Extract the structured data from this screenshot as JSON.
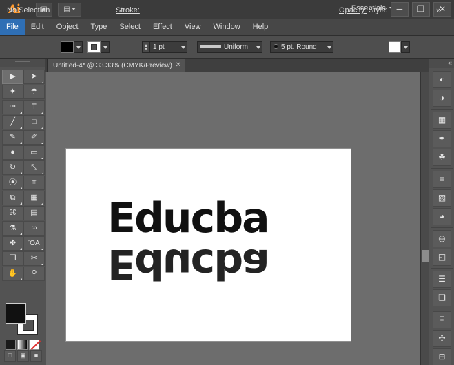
{
  "app": {
    "name": "Ai",
    "logo_label": "Ai"
  },
  "titlebar": {
    "bridge_button": "▣",
    "arrange_button": "▤",
    "workspace": "Essentials",
    "minimize": "─",
    "maximize": "❐",
    "close": "✕"
  },
  "menubar": {
    "items": [
      {
        "label": "File",
        "active": true
      },
      {
        "label": "Edit",
        "active": false
      },
      {
        "label": "Object",
        "active": false
      },
      {
        "label": "Type",
        "active": false
      },
      {
        "label": "Select",
        "active": false
      },
      {
        "label": "Effect",
        "active": false
      },
      {
        "label": "View",
        "active": false
      },
      {
        "label": "Window",
        "active": false
      },
      {
        "label": "Help",
        "active": false
      }
    ]
  },
  "controlbar": {
    "selection_status": "No Selection",
    "fill_color": "#000000",
    "stroke_color": "#ffffff",
    "stroke_label": "Stroke:",
    "stroke_weight": "1 pt",
    "stroke_profile": "Uniform",
    "brush_definition": "5 pt. Round",
    "opacity_label": "Opacity:",
    "opacity_value": "",
    "style_label": "Style:",
    "style_value": "",
    "overflow_menu": "»"
  },
  "document": {
    "tab_title": "Untitled-4* @ 33.33% (CMYK/Preview)",
    "tab_close": "✕",
    "zoom": "33.33%",
    "color_mode": "CMYK/Preview"
  },
  "artwork": {
    "text": "Educba",
    "reflection_text": "Educba",
    "color": "#111111"
  },
  "toolbox": {
    "tools": [
      {
        "name": "selection-tool",
        "glyph": "▶",
        "selected": true,
        "hasflyout": false
      },
      {
        "name": "direct-selection-tool",
        "glyph": "➤",
        "selected": false,
        "hasflyout": true
      },
      {
        "name": "magic-wand-tool",
        "glyph": "✦",
        "selected": false,
        "hasflyout": false
      },
      {
        "name": "lasso-tool",
        "glyph": "☂",
        "selected": false,
        "hasflyout": false
      },
      {
        "name": "pen-tool",
        "glyph": "✑",
        "selected": false,
        "hasflyout": true
      },
      {
        "name": "type-tool",
        "glyph": "T",
        "selected": false,
        "hasflyout": true
      },
      {
        "name": "line-segment-tool",
        "glyph": "╱",
        "selected": false,
        "hasflyout": true
      },
      {
        "name": "rectangle-tool",
        "glyph": "□",
        "selected": false,
        "hasflyout": true
      },
      {
        "name": "paintbrush-tool",
        "glyph": "✎",
        "selected": false,
        "hasflyout": true
      },
      {
        "name": "pencil-tool",
        "glyph": "✐",
        "selected": false,
        "hasflyout": true
      },
      {
        "name": "blob-brush-tool",
        "glyph": "●",
        "selected": false,
        "hasflyout": false
      },
      {
        "name": "eraser-tool",
        "glyph": "▭",
        "selected": false,
        "hasflyout": true
      },
      {
        "name": "rotate-tool",
        "glyph": "↻",
        "selected": false,
        "hasflyout": true
      },
      {
        "name": "scale-tool",
        "glyph": "⤡",
        "selected": false,
        "hasflyout": true
      },
      {
        "name": "width-tool",
        "glyph": "⦿",
        "selected": false,
        "hasflyout": true
      },
      {
        "name": "free-transform-tool",
        "glyph": "⌗",
        "selected": false,
        "hasflyout": false
      },
      {
        "name": "shape-builder-tool",
        "glyph": "⧉",
        "selected": false,
        "hasflyout": true
      },
      {
        "name": "perspective-grid-tool",
        "glyph": "▦",
        "selected": false,
        "hasflyout": true
      },
      {
        "name": "mesh-tool",
        "glyph": "⌘",
        "selected": false,
        "hasflyout": false
      },
      {
        "name": "gradient-tool",
        "glyph": "▤",
        "selected": false,
        "hasflyout": false
      },
      {
        "name": "eyedropper-tool",
        "glyph": "⚗",
        "selected": false,
        "hasflyout": true
      },
      {
        "name": "blend-tool",
        "glyph": "∞",
        "selected": false,
        "hasflyout": false
      },
      {
        "name": "symbol-sprayer-tool",
        "glyph": "✤",
        "selected": false,
        "hasflyout": true
      },
      {
        "name": "column-graph-tool",
        "glyph": "ὌA",
        "selected": false,
        "hasflyout": true
      },
      {
        "name": "artboard-tool",
        "glyph": "❐",
        "selected": false,
        "hasflyout": false
      },
      {
        "name": "slice-tool",
        "glyph": "✂",
        "selected": false,
        "hasflyout": true
      },
      {
        "name": "hand-tool",
        "glyph": "✋",
        "selected": false,
        "hasflyout": true
      },
      {
        "name": "zoom-tool",
        "glyph": "⚲",
        "selected": false,
        "hasflyout": false
      }
    ],
    "fill_color": "#000000",
    "stroke_color": "#ffffff",
    "swatch_row": [
      {
        "name": "color-swatch",
        "color": "#1a1a1a"
      },
      {
        "name": "gradient-swatch",
        "color": "#ffffff"
      },
      {
        "name": "none-swatch",
        "color": "#ffffff"
      }
    ],
    "screen_modes": [
      {
        "name": "normal-screen-mode",
        "glyph": "□"
      },
      {
        "name": "full-screen-menu-mode",
        "glyph": "▣"
      },
      {
        "name": "full-screen-mode",
        "glyph": "■"
      }
    ]
  },
  "dock": {
    "collapse_glyph": "«",
    "panels": [
      {
        "name": "color-panel",
        "glyph": "◐"
      },
      {
        "name": "color-guide-panel",
        "glyph": "◑"
      },
      {
        "name": "swatches-panel",
        "glyph": "▦"
      },
      {
        "name": "brushes-panel",
        "glyph": "✒"
      },
      {
        "name": "symbols-panel",
        "glyph": "☘"
      },
      {
        "name": "stroke-panel",
        "glyph": "≡"
      },
      {
        "name": "gradient-panel",
        "glyph": "▨"
      },
      {
        "name": "transparency-panel",
        "glyph": "◕"
      },
      {
        "name": "appearance-panel",
        "glyph": "◎"
      },
      {
        "name": "graphic-styles-panel",
        "glyph": "◱"
      },
      {
        "name": "layers-panel",
        "glyph": "☰"
      },
      {
        "name": "artboards-panel",
        "glyph": "❑"
      },
      {
        "name": "align-panel",
        "glyph": "⌸"
      },
      {
        "name": "transform-panel",
        "glyph": "✣"
      },
      {
        "name": "pathfinder-panel",
        "glyph": "⊞"
      }
    ]
  },
  "scrollbar": {
    "vertical_thumb_name": "vertical-scrollbar-thumb"
  }
}
